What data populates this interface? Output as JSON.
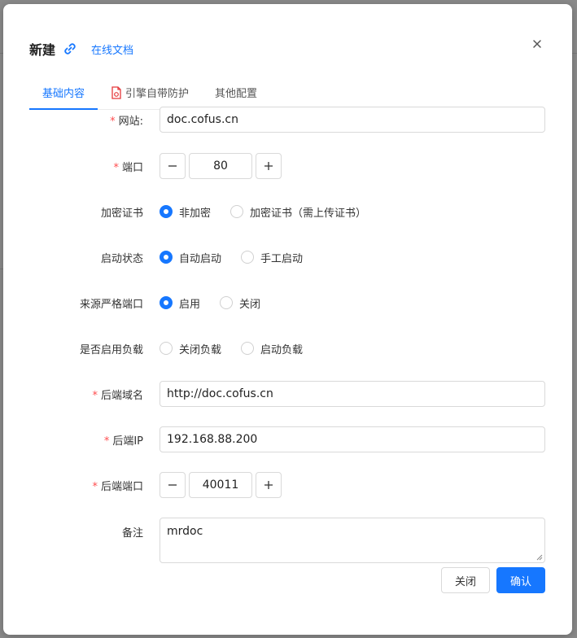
{
  "modal": {
    "title": "新建",
    "doc_link": "在线文档",
    "link_icon": "link-icon",
    "close_icon": "close-icon"
  },
  "tabs": [
    {
      "label": "基础内容",
      "active": true
    },
    {
      "label": "引擎自带防护",
      "icon": "file-shield-icon",
      "active": false
    },
    {
      "label": "其他配置",
      "active": false
    }
  ],
  "form": {
    "site": {
      "label": "网站:",
      "required": true,
      "value": "doc.cofus.cn"
    },
    "port": {
      "label": "端口",
      "required": true,
      "value": "80",
      "minus": "minus-icon",
      "plus": "plus-icon"
    },
    "ssl": {
      "label": "加密证书",
      "options": [
        "非加密",
        "加密证书（需上传证书）"
      ],
      "selected": 0
    },
    "startup": {
      "label": "启动状态",
      "options": [
        "自动启动",
        "手工启动"
      ],
      "selected": 0
    },
    "strict_port": {
      "label": "来源严格端口",
      "options": [
        "启用",
        "关闭"
      ],
      "selected": 0
    },
    "load_balance": {
      "label": "是否启用负载",
      "options": [
        "关闭负载",
        "启动负载"
      ],
      "selected": null
    },
    "backend_domain": {
      "label": "后端域名",
      "required": true,
      "value": "http://doc.cofus.cn"
    },
    "backend_ip": {
      "label": "后端IP",
      "required": true,
      "value": "192.168.88.200"
    },
    "backend_port": {
      "label": "后端端口",
      "required": true,
      "value": "40011"
    },
    "remark": {
      "label": "备注",
      "value": "mrdoc"
    }
  },
  "footer": {
    "cancel_label": "关闭",
    "confirm_label": "确认"
  },
  "colors": {
    "primary": "#1677ff",
    "required": "#ff4d4f"
  }
}
